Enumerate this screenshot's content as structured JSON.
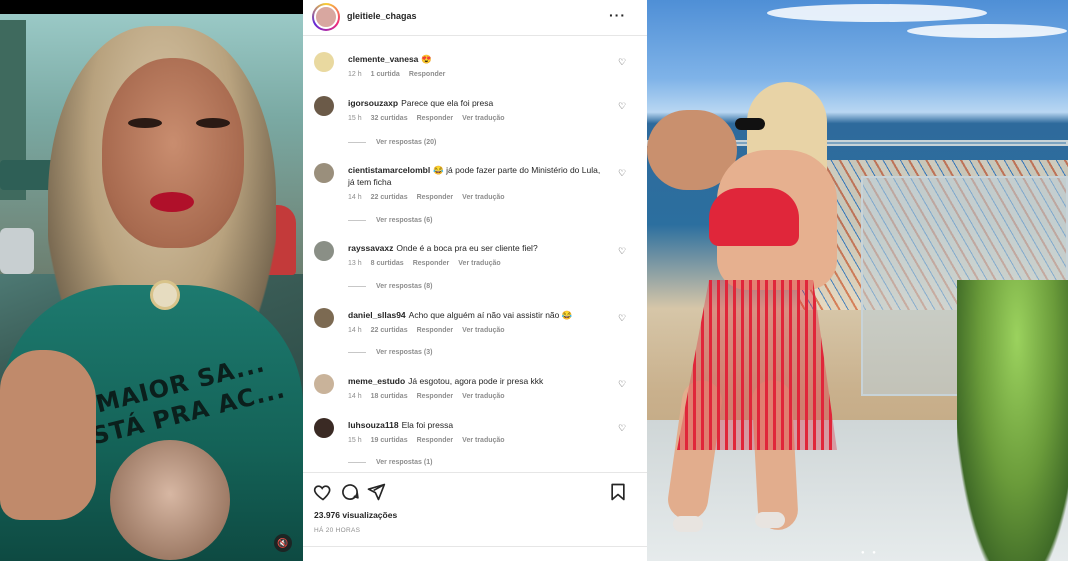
{
  "post": {
    "username": "gleitiele_chagas",
    "views": "23.976 visualizações",
    "posted_ago": "HÁ 20 HORAS"
  },
  "video": {
    "shirt_text": "A MAIOR SA... ESTÁ PRA AC..."
  },
  "comments": [
    {
      "user": "clemente_vanesa",
      "text": "😍",
      "time": "12 h",
      "likes": "1 curtida",
      "reply": "Responder",
      "translate": "",
      "replies": ""
    },
    {
      "user": "igorsouzaxp",
      "text": "Parece que ela foi presa",
      "time": "15 h",
      "likes": "32 curtidas",
      "reply": "Responder",
      "translate": "Ver tradução",
      "replies": "Ver respostas (20)"
    },
    {
      "user": "cientistamarcelombl",
      "text": "😂 já pode fazer parte do Ministério do Lula, já tem ficha",
      "time": "14 h",
      "likes": "22 curtidas",
      "reply": "Responder",
      "translate": "Ver tradução",
      "replies": "Ver respostas (6)"
    },
    {
      "user": "rayssavaxz",
      "text": "Onde é a boca pra eu ser cliente fiel?",
      "time": "13 h",
      "likes": "8 curtidas",
      "reply": "Responder",
      "translate": "Ver tradução",
      "replies": "Ver respostas (8)"
    },
    {
      "user": "daniel_sllas94",
      "text": "Acho que alguém aí não vai assistir não 😂",
      "time": "14 h",
      "likes": "22 curtidas",
      "reply": "Responder",
      "translate": "Ver tradução",
      "replies": "Ver respostas (3)"
    },
    {
      "user": "meme_estudo",
      "text": "Já esgotou, agora pode ir presa kkk",
      "time": "14 h",
      "likes": "18 curtidas",
      "reply": "Responder",
      "translate": "Ver tradução",
      "replies": ""
    },
    {
      "user": "luhsouza118",
      "text": "Ela foi pressa",
      "time": "15 h",
      "likes": "19 curtidas",
      "reply": "Responder",
      "translate": "Ver tradução",
      "replies": "Ver respostas (1)"
    }
  ],
  "icons": {
    "more": "more-options-icon",
    "heart": "heart-icon",
    "comment": "comment-icon",
    "share": "share-icon",
    "save": "bookmark-icon",
    "mute": "speaker-icon"
  },
  "colors": {
    "meta_gray": "#8e8e8e",
    "text": "#262626",
    "bikini_red": "#e0263a",
    "shirt_teal": "#1d7a6f"
  }
}
